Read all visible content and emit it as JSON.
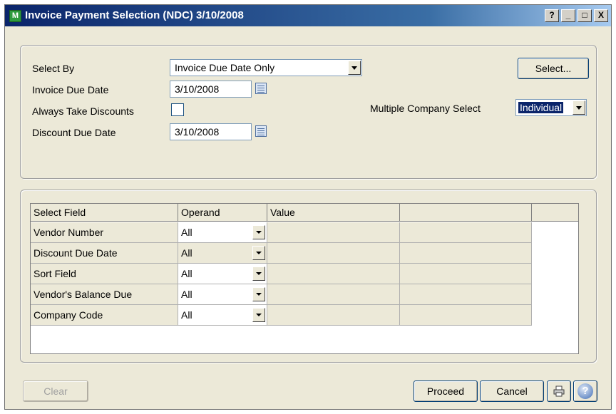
{
  "window": {
    "title": "Invoice Payment Selection (NDC) 3/10/2008",
    "icon_letter": "M",
    "help_btn": "?",
    "minimize_btn": "_",
    "maximize_btn": "□",
    "close_btn": "X"
  },
  "criteria": {
    "select_by_label": "Select By",
    "select_by_value": "Invoice Due Date Only",
    "invoice_due_date_label": "Invoice Due Date",
    "invoice_due_date_value": "3/10/2008",
    "always_take_discounts_label": "Always Take Discounts",
    "always_take_discounts_checked": false,
    "discount_due_date_label": "Discount Due Date",
    "discount_due_date_value": "3/10/2008",
    "multiple_company_label": "Multiple Company Select",
    "multiple_company_value": "Individual",
    "select_button_label": "Select..."
  },
  "grid": {
    "columns": [
      "Select Field",
      "Operand",
      "Value",
      ""
    ],
    "rows": [
      {
        "field": "Vendor Number",
        "operand": "All",
        "value": ""
      },
      {
        "field": "Discount Due Date",
        "operand": "All",
        "value": ""
      },
      {
        "field": "Sort Field",
        "operand": "All",
        "value": ""
      },
      {
        "field": "Vendor's Balance Due",
        "operand": "All",
        "value": ""
      },
      {
        "field": "Company Code",
        "operand": "All",
        "value": ""
      }
    ]
  },
  "footer": {
    "clear_label": "Clear",
    "proceed_label": "Proceed",
    "cancel_label": "Cancel"
  },
  "icons": {
    "app": "app-icon",
    "calendar": "calendar-icon",
    "printer": "printer-icon",
    "help": "help-icon"
  },
  "colors": {
    "title_start": "#0a246a",
    "title_end": "#a6caf0",
    "window_bg": "#ece9d8",
    "selection": "#0a246a"
  }
}
